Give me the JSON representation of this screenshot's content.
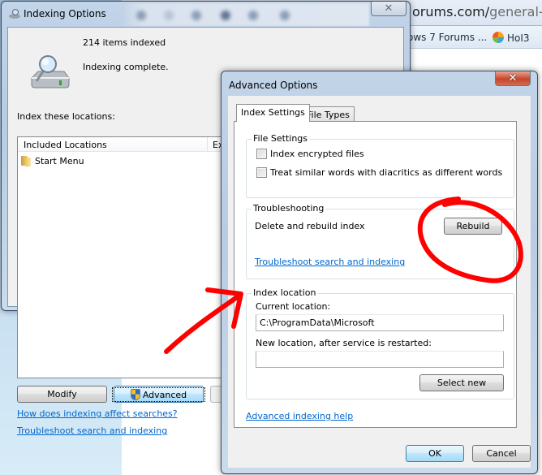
{
  "browser": {
    "address_host_fragment": "orums.com/",
    "address_path_fragment": "general-discu",
    "favorites": [
      {
        "label": "ows 7 Forums ...",
        "icon": "page-icon"
      },
      {
        "label": "HoI3",
        "icon": "colorful-swirl-icon"
      }
    ]
  },
  "indexing_window": {
    "title": "Indexing Options",
    "close_symbol": "✕",
    "items_indexed": "214 items indexed",
    "status": "Indexing complete.",
    "locations_label": "Index these locations:",
    "list": {
      "columns": [
        "Included Locations",
        "Exclude"
      ],
      "visible_columns": [
        "Included Locations",
        "Exc"
      ],
      "rows": [
        {
          "location": "Start Menu",
          "icon": "folder-icon"
        }
      ]
    },
    "buttons": {
      "modify": "Modify",
      "advanced": "Advanced"
    },
    "links": {
      "how_affects": "How does indexing affect searches?",
      "troubleshoot": "Troubleshoot search and indexing"
    }
  },
  "advanced_window": {
    "title": "Advanced Options",
    "close_symbol": "✕",
    "tabs": [
      {
        "label": "Index Settings",
        "selected": true
      },
      {
        "label": "File Types",
        "selected": false
      }
    ],
    "file_settings": {
      "legend": "File Settings",
      "options": [
        {
          "label": "Index encrypted files",
          "checked": false
        },
        {
          "label": "Treat similar words with diacritics as different words",
          "checked": false
        }
      ]
    },
    "troubleshooting": {
      "legend": "Troubleshooting",
      "rebuild_label": "Delete and rebuild index",
      "rebuild_button": "Rebuild",
      "link": "Troubleshoot search and indexing"
    },
    "index_location": {
      "legend": "Index location",
      "current_label": "Current location:",
      "current_value": "C:\\ProgramData\\Microsoft",
      "new_label": "New location, after service is restarted:",
      "new_value": "",
      "select_new_button": "Select new"
    },
    "help_link": "Advanced indexing help",
    "ok_button": "OK",
    "cancel_button": "Cancel"
  },
  "annotations": {
    "color": "#ff0000",
    "items": [
      "red-arrow-advanced-to-index-location",
      "red-circle-around-rebuild"
    ]
  }
}
